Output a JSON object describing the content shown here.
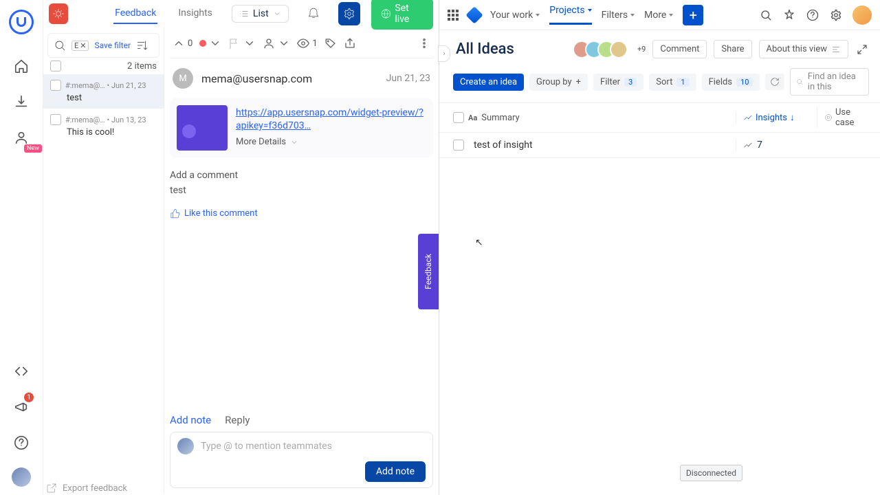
{
  "usersnap": {
    "tabs": {
      "feedback": "Feedback",
      "insights": "Insights"
    },
    "list_button": "List",
    "set_live": "Set live",
    "filter": {
      "letter": "E",
      "save": "Save filter"
    },
    "items_count": "2 items",
    "items": [
      {
        "id": "#:mema@…",
        "date": "Jun 21, 23",
        "body": "test"
      },
      {
        "id": "#:mema@…",
        "date": "Jun 13, 23",
        "body": "This is cool!"
      }
    ],
    "detail": {
      "nav_count": "0",
      "view_count": "1",
      "author_initial": "M",
      "author_email": "mema@usersnap.com",
      "date": "Jun 21, 23",
      "link": "https://app.usersnap.com/widget-preview/?apikey=f36d703…",
      "more_details": "More Details",
      "comment_label": "Add a comment",
      "comment_body": "test",
      "like": "Like this comment"
    },
    "feedback_tab": "Feedback",
    "note": {
      "tab_add": "Add note",
      "tab_reply": "Reply",
      "placeholder": "Type @ to mention teammates",
      "button": "Add note"
    },
    "export": "Export feedback",
    "announce_count": "1",
    "new_label": "New"
  },
  "jira": {
    "nav": {
      "your_work": "Your work",
      "projects": "Projects",
      "filters": "Filters",
      "more": "More"
    },
    "view_title": "All Ideas",
    "avatars_more": "+9",
    "buttons": {
      "comment": "Comment",
      "share": "Share",
      "about": "About this view"
    },
    "chips": {
      "create": "Create an idea",
      "group": "Group by",
      "filter": "Filter",
      "filter_n": "3",
      "sort": "Sort",
      "sort_n": "1",
      "fields": "Fields",
      "fields_n": "10"
    },
    "find_placeholder": "Find an idea in this",
    "columns": {
      "summary": "Summary",
      "insights": "Insights",
      "usecase": "Use case"
    },
    "rows": [
      {
        "summary": "test of insight",
        "insights": "7"
      }
    ],
    "disconnected": "Disconnected"
  }
}
